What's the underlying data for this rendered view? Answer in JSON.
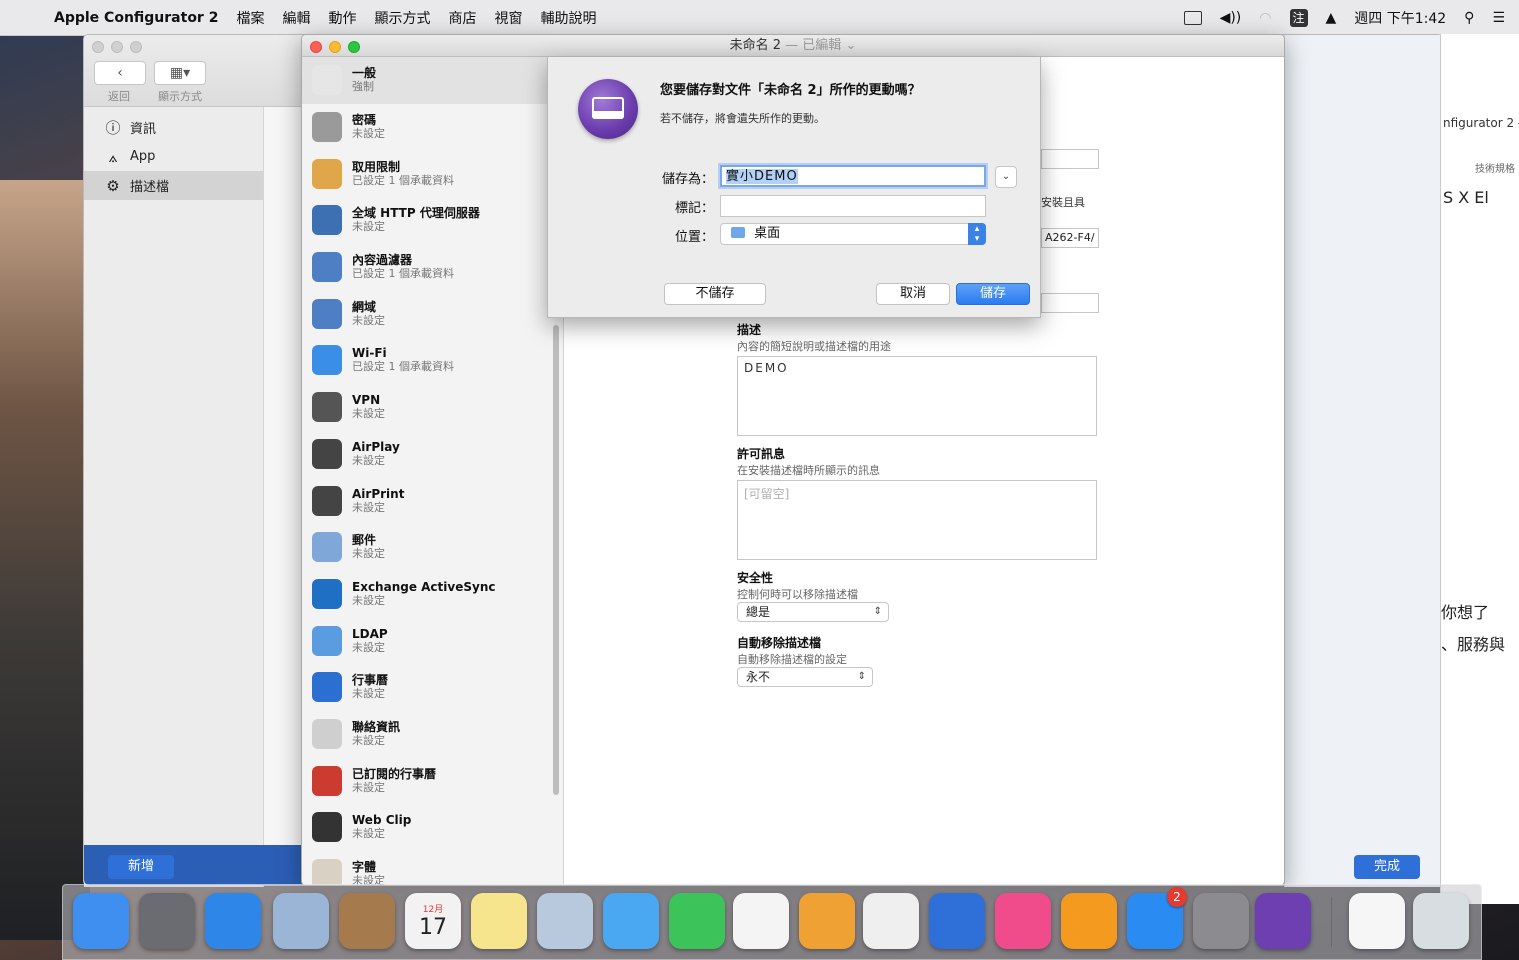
{
  "menubar": {
    "app_name": "Apple Configurator 2",
    "items": [
      "檔案",
      "編輯",
      "動作",
      "顯示方式",
      "商店",
      "視窗",
      "輔助說明"
    ],
    "clock": "週四 下午1:42"
  },
  "back_window": {
    "nav_back_label": "返回",
    "nav_view_label": "顯示方式",
    "sidebar": [
      {
        "icon": "info-icon",
        "label": "資訊"
      },
      {
        "icon": "app-icon",
        "label": "App"
      },
      {
        "icon": "gear-icon",
        "label": "描述檔"
      }
    ],
    "new_button": "新增",
    "done_button": "完成",
    "peek_texts": [
      "nfigurator 2 - V",
      "技術規格",
      "S X El",
      "你想了",
      "、服務與"
    ]
  },
  "main_window": {
    "title": "未命名 2",
    "title_state": "— 已編輯",
    "payloads": [
      {
        "icon": "general-icon",
        "name": "一般",
        "status": "強制",
        "color": "#e6e6e6"
      },
      {
        "icon": "key-icon",
        "name": "密碼",
        "status": "未設定",
        "color": "#9a9a9a"
      },
      {
        "icon": "lock-icon",
        "name": "取用限制",
        "status": "已設定 1 個承載資料",
        "color": "#e0a64a"
      },
      {
        "icon": "globe-icon",
        "name": "全域 HTTP 代理伺服器",
        "status": "未設定",
        "color": "#3d6fb3"
      },
      {
        "icon": "filter-icon",
        "name": "內容過濾器",
        "status": "已設定 1 個承載資料",
        "color": "#4e7fc4"
      },
      {
        "icon": "domain-icon",
        "name": "網域",
        "status": "未設定",
        "color": "#4e7fc4"
      },
      {
        "icon": "wifi-icon",
        "name": "Wi-Fi",
        "status": "已設定 1 個承載資料",
        "color": "#3a8ee6"
      },
      {
        "icon": "vpn-icon",
        "name": "VPN",
        "status": "未設定",
        "color": "#555555"
      },
      {
        "icon": "airplay-icon",
        "name": "AirPlay",
        "status": "未設定",
        "color": "#444444"
      },
      {
        "icon": "printer-icon",
        "name": "AirPrint",
        "status": "未設定",
        "color": "#444444"
      },
      {
        "icon": "mail-icon",
        "name": "郵件",
        "status": "未設定",
        "color": "#7fa7d8"
      },
      {
        "icon": "exchange-icon",
        "name": "Exchange ActiveSync",
        "status": "未設定",
        "color": "#1f6fc5"
      },
      {
        "icon": "ldap-icon",
        "name": "LDAP",
        "status": "未設定",
        "color": "#5b9be0"
      },
      {
        "icon": "calendar-icon",
        "name": "行事曆",
        "status": "未設定",
        "color": "#2b6fd0"
      },
      {
        "icon": "contacts-icon",
        "name": "聯絡資訊",
        "status": "未設定",
        "color": "#cfcfcf"
      },
      {
        "icon": "subscribed-calendar-icon",
        "name": "已訂閱的行事曆",
        "status": "未設定",
        "color": "#cc3b2f"
      },
      {
        "icon": "webclip-icon",
        "name": "Web Clip",
        "status": "未設定",
        "color": "#333333"
      },
      {
        "icon": "font-icon",
        "name": "字體",
        "status": "未設定",
        "color": "#d9d2c4"
      }
    ],
    "form": {
      "partial_text_1": "安裝且具",
      "partial_text_2": "A262-F4/",
      "description_label": "描述",
      "description_sub": "內容的簡短說明或描述檔的用途",
      "description_value": "DEMO",
      "consent_label": "許可訊息",
      "consent_sub": "在安裝描述檔時所顯示的訊息",
      "consent_placeholder": "[可留空]",
      "security_label": "安全性",
      "security_sub": "控制何時可以移除描述檔",
      "security_value": "總是",
      "auto_remove_label": "自動移除描述檔",
      "auto_remove_sub": "自動移除描述檔的設定",
      "auto_remove_value": "永不"
    }
  },
  "sheet": {
    "question": "您要儲存對文件「未命名 2」所作的更動嗎？",
    "subtext": "若不儲存，將會遺失所作的更動。",
    "save_as_label": "儲存為：",
    "save_as_value": "實小DEMO",
    "tags_label": "標記：",
    "tags_value": "",
    "where_label": "位置：",
    "where_value": "桌面",
    "dont_save": "不儲存",
    "cancel": "取消",
    "save": "儲存"
  },
  "dock": {
    "items": [
      {
        "name": "finder-icon",
        "color": "#3e8ff0"
      },
      {
        "name": "launchpad-icon",
        "color": "#6b6b72"
      },
      {
        "name": "safari-icon",
        "color": "#2d86e8"
      },
      {
        "name": "mail-app-icon",
        "color": "#9ab5d6"
      },
      {
        "name": "contacts-app-icon",
        "color": "#a57a4d"
      },
      {
        "name": "calendar-app-icon",
        "color": "#f2f2f2",
        "text": "17",
        "month": "12月"
      },
      {
        "name": "notes-icon",
        "color": "#f6e58d"
      },
      {
        "name": "preview-icon",
        "color": "#b8c9de"
      },
      {
        "name": "messages-icon",
        "color": "#4aa8f2"
      },
      {
        "name": "facetime-icon",
        "color": "#3cc45a"
      },
      {
        "name": "photos-icon",
        "color": "#f4f4f4"
      },
      {
        "name": "pages-icon",
        "color": "#f0a134"
      },
      {
        "name": "numbers-icon",
        "color": "#efefef"
      },
      {
        "name": "keynote-icon",
        "color": "#2e6fd8"
      },
      {
        "name": "itunes-icon",
        "color": "#f04c8c"
      },
      {
        "name": "ibooks-icon",
        "color": "#f39a1f"
      },
      {
        "name": "app-store-icon",
        "color": "#2a8cf2",
        "badge": "2"
      },
      {
        "name": "system-preferences-icon",
        "color": "#8c8c90"
      },
      {
        "name": "apple-configurator-icon",
        "color": "#6d3fb0"
      },
      {
        "name": "document-icon",
        "color": "#f6f6f6"
      },
      {
        "name": "trash-icon",
        "color": "#d8dde2"
      }
    ]
  }
}
